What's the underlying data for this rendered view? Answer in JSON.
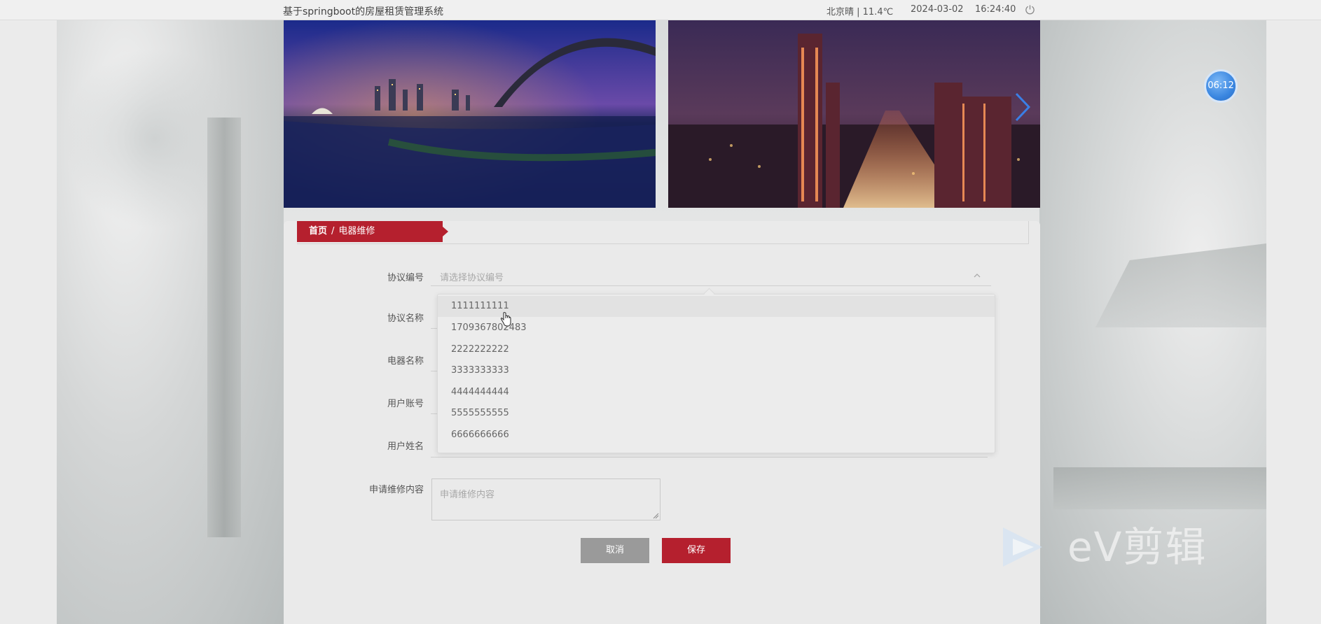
{
  "topbar": {
    "title": "基于springboot的房屋租赁管理系统",
    "weather": "北京晴 | 11.4℃",
    "date": "2024-03-02",
    "time": "16:24:40",
    "power_icon": "power-icon"
  },
  "breadcrumb": {
    "home": "首页",
    "separator": "/",
    "current": "电器维修"
  },
  "form": {
    "labels": {
      "agreement_no": "协议编号",
      "agreement_name": "协议名称",
      "appliance_name": "电器名称",
      "user_account": "用户账号",
      "user_name": "用户姓名",
      "repair_content": "申请维修内容"
    },
    "agreement_placeholder": "请选择协议编号",
    "repair_placeholder": "申请维修内容",
    "dropdown_options": [
      "1111111111",
      "1709367802483",
      "2222222222",
      "3333333333",
      "4444444444",
      "5555555555",
      "6666666666"
    ],
    "hovered_option_index": 0,
    "cancel_label": "取消",
    "save_label": "保存"
  },
  "timer": {
    "label": "06:12"
  },
  "watermark": {
    "text": "eV剪辑"
  },
  "colors": {
    "accent": "#b5202e",
    "cancel": "#9a9a9a",
    "timer_blue": "#3a86e0"
  }
}
